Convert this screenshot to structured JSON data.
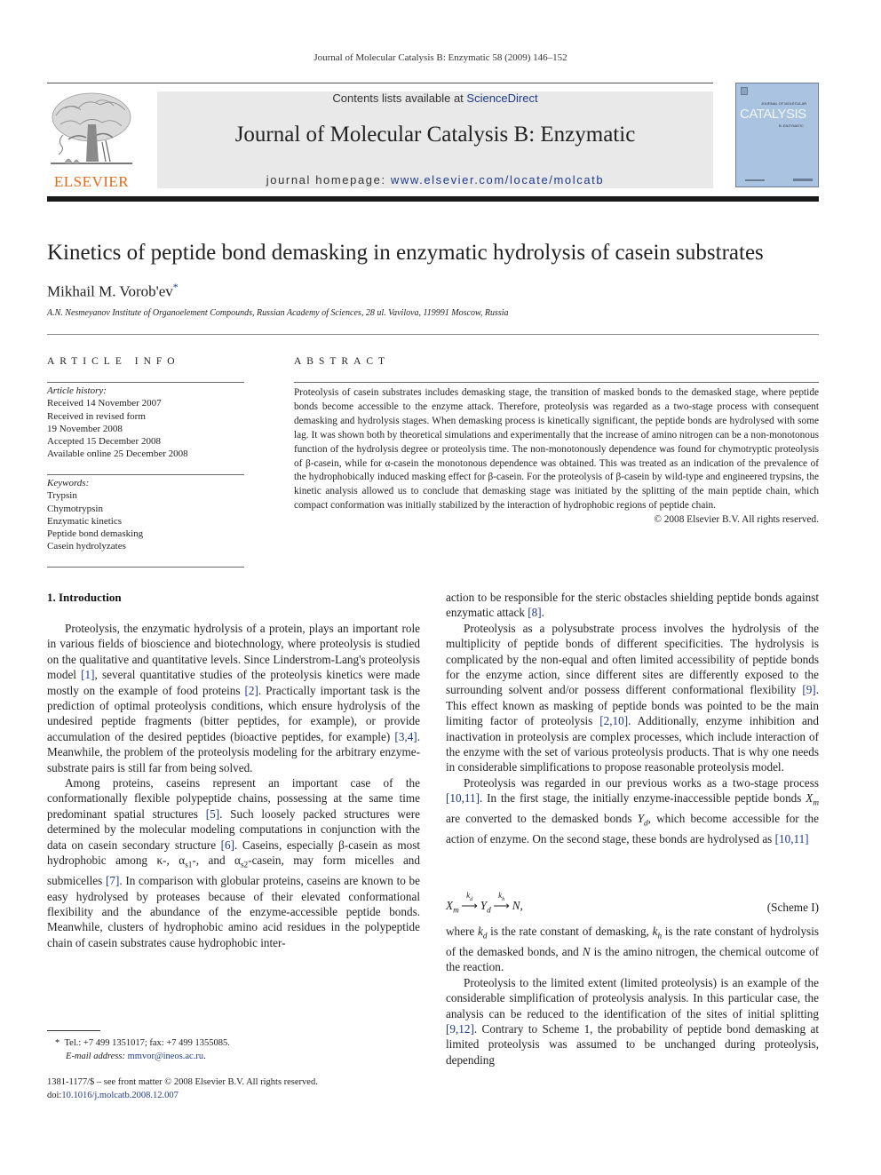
{
  "running_head": "Journal of Molecular Catalysis B: Enzymatic 58 (2009) 146–152",
  "masthead": {
    "contents_prefix": "Contents lists available at ",
    "contents_link": "ScienceDirect",
    "journal_name": "Journal of Molecular Catalysis B: Enzymatic",
    "homepage_prefix": "journal homepage: ",
    "homepage_link": "www.elsevier.com/locate/molcatb",
    "publisher_logo_text": "ELSEVIER",
    "cover": {
      "title": "CATALYSIS",
      "supertitle": "JOURNAL OF MOLECULAR",
      "subtitle": "B: ENZYMATIC",
      "color": "#a9c3e0"
    }
  },
  "article": {
    "title": "Kinetics of peptide bond demasking in enzymatic hydrolysis of casein substrates",
    "author": "Mikhail M. Vorob'ev",
    "author_mark": "*",
    "affiliation": "A.N. Nesmeyanov Institute of Organoelement Compounds, Russian Academy of Sciences, 28 ul. Vavilova, 119991 Moscow, Russia"
  },
  "article_info": {
    "heading": "ARTICLE INFO",
    "history_label": "Article history:",
    "history": [
      "Received 14 November 2007",
      "Received in revised form",
      "19 November 2008",
      "Accepted 15 December 2008",
      "Available online 25 December 2008"
    ],
    "keywords_label": "Keywords:",
    "keywords": [
      "Trypsin",
      "Chymotrypsin",
      "Enzymatic kinetics",
      "Peptide bond demasking",
      "Casein hydrolyzates"
    ]
  },
  "abstract": {
    "heading": "ABSTRACT",
    "text": "Proteolysis of casein substrates includes demasking stage, the transition of masked bonds to the demasked stage, where peptide bonds become accessible to the enzyme attack. Therefore, proteolysis was regarded as a two-stage process with consequent demasking and hydrolysis stages. When demasking process is kinetically significant, the peptide bonds are hydrolysed with some lag. It was shown both by theoretical simulations and experimentally that the increase of amino nitrogen can be a non-monotonous function of the hydrolysis degree or proteolysis time. The non-monotonously dependence was found for chymotryptic proteolysis of β-casein, while for α-casein the monotonous dependence was obtained. This was treated as an indication of the prevalence of the hydrophobically induced masking effect for β-casein. For the proteolysis of β-casein by wild-type and engineered trypsins, the kinetic analysis allowed us to conclude that demasking stage was initiated by the splitting of the main peptide chain, which compact conformation was initially stabilized by the interaction of hydrophobic regions of peptide chain.",
    "copyright": "© 2008 Elsevier B.V. All rights reserved."
  },
  "body": {
    "section_heading": "1.  Introduction",
    "left_col": {
      "p1": [
        {
          "t": "Proteolysis, the enzymatic hydrolysis of a protein, plays an important role in various fields of bioscience and biotechnology, where proteolysis is studied on the qualitative and quantitative levels. Since Linderstrom-Lang's proteolysis model "
        },
        {
          "ref": "[1]"
        },
        {
          "t": ", several quantitative studies of the proteolysis kinetics were made mostly on the example of food proteins "
        },
        {
          "ref": "[2]"
        },
        {
          "t": ". Practically important task is the prediction of optimal proteolysis conditions, which ensure hydrolysis of the undesired peptide fragments (bitter peptides, for example), or provide accumulation of the desired peptides (bioactive peptides, for example) "
        },
        {
          "ref": "[3,4]"
        },
        {
          "t": ". Meanwhile, the problem of the proteolysis modeling for the arbitrary enzyme-substrate pairs is still far from being solved."
        }
      ],
      "p2": [
        {
          "t": "Among proteins, caseins represent an important case of the conformationally flexible polypeptide chains, possessing at the same time predominant spatial structures "
        },
        {
          "ref": "[5]"
        },
        {
          "t": ". Such loosely packed structures were determined by the molecular modeling computations in conjunction with the data on casein secondary structure "
        },
        {
          "ref": "[6]"
        },
        {
          "t": ". Caseins, especially β-casein as most hydrophobic among κ-, α"
        },
        {
          "sub": "s1"
        },
        {
          "t": "-, and α"
        },
        {
          "sub": "s2"
        },
        {
          "t": "-casein, may form micelles and submicelles "
        },
        {
          "ref": "[7]"
        },
        {
          "t": ". In comparison with globular proteins, caseins are known to be easy hydrolysed by proteases because of their elevated conformational flexibility and the abundance of the enzyme-accessible peptide bonds. Meanwhile, clusters of hydrophobic amino acid residues in the polypeptide chain of casein substrates cause hydrophobic inter-"
        }
      ]
    },
    "right_col": {
      "p0": [
        {
          "t": "action to be responsible for the steric obstacles shielding peptide bonds against enzymatic attack "
        },
        {
          "ref": "[8]"
        },
        {
          "t": "."
        }
      ],
      "p1": [
        {
          "t": "Proteolysis as a polysubstrate process involves the hydrolysis of the multiplicity of peptide bonds of different specificities. The hydrolysis is complicated by the non-equal and often limited accessibility of peptide bonds for the enzyme action, since different sites are differently exposed to the surrounding solvent and/or possess different conformational flexibility "
        },
        {
          "ref": "[9]"
        },
        {
          "t": ". This effect known as masking of peptide bonds was pointed to be the main limiting factor of proteolysis "
        },
        {
          "ref": "[2,10]"
        },
        {
          "t": ". Additionally, enzyme inhibition and inactivation in proteolysis are complex processes, which include interaction of the enzyme with the set of various proteolysis products. That is why one needs in considerable simplifications to propose reasonable proteolysis model."
        }
      ],
      "p2": [
        {
          "t": "Proteolysis was regarded in our previous works as a two-stage process "
        },
        {
          "ref": "[10,11]"
        },
        {
          "t": ". In the first stage, the initially enzyme-inaccessible peptide bonds "
        },
        {
          "i": "X"
        },
        {
          "isub": "m"
        },
        {
          "t": " are converted to the demasked bonds "
        },
        {
          "i": "Y"
        },
        {
          "isub": "d"
        },
        {
          "t": ", which become accessible for the action of enzyme. On the second stage, these bonds are hydrolysed as "
        },
        {
          "ref": "[10,11]"
        }
      ],
      "scheme": {
        "x": "X",
        "x_sub": "m",
        "k1": "k",
        "k1_sub": "d",
        "y": "Y",
        "y_sub": "d",
        "k2": "k",
        "k2_sub": "h",
        "n": "N",
        "tag": "(Scheme I)"
      },
      "p3": [
        {
          "t": "where "
        },
        {
          "i": "k"
        },
        {
          "isub": "d"
        },
        {
          "t": " is the rate constant of demasking, "
        },
        {
          "i": "k"
        },
        {
          "isub": "h"
        },
        {
          "t": " is the rate constant of hydrolysis of the demasked bonds, and "
        },
        {
          "i": "N"
        },
        {
          "t": " is the amino nitrogen, the chemical outcome of the reaction."
        }
      ],
      "p4": [
        {
          "t": "Proteolysis to the limited extent (limited proteolysis) is an example of the considerable simplification of proteolysis analysis. In this particular case, the analysis can be reduced to the identification of the sites of initial splitting "
        },
        {
          "ref": "[9,12]"
        },
        {
          "t": ". Contrary to Scheme 1, the probability of peptide bond demasking at limited proteolysis was assumed to be unchanged during proteolysis, depending"
        }
      ]
    }
  },
  "footnote": {
    "mark": "*",
    "contact": "Tel.: +7 499 1351017; fax: +7 499 1355085.",
    "email_label": "E-mail address: ",
    "email": "mmvor@ineos.ac.ru",
    "email_suffix": "."
  },
  "front_matter": {
    "issn_line": "1381-1177/$ – see front matter © 2008 Elsevier B.V. All rights reserved.",
    "doi_label": "doi:",
    "doi": "10.1016/j.molcatb.2008.12.007"
  },
  "colors": {
    "link": "#1f3a8a",
    "elsevier_orange": "#e36c1a",
    "banner_gray": "#e9e9e9"
  }
}
